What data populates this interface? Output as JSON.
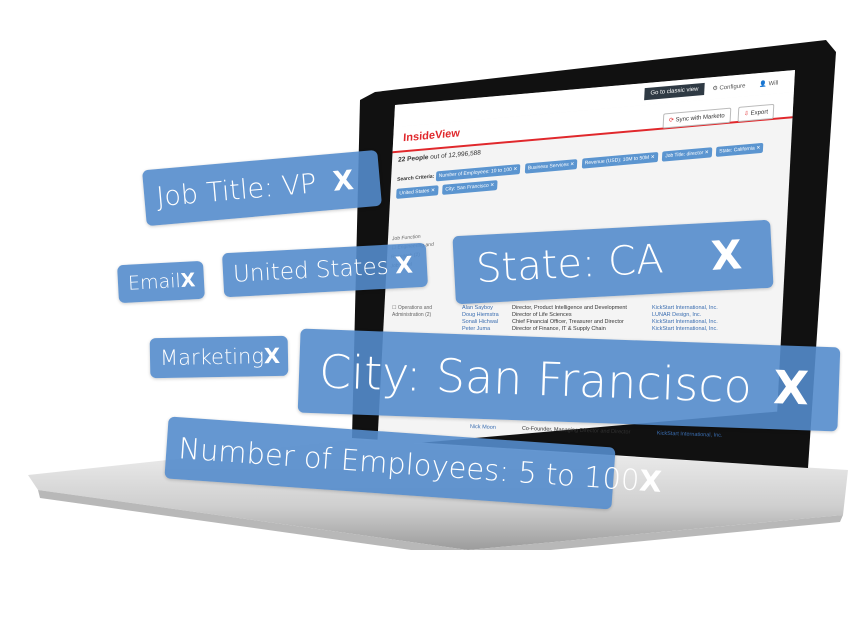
{
  "app": {
    "brand": "InsideView",
    "classic_view_button": "Go to classic view",
    "configure": "Configure",
    "user": "Will",
    "sync_button": "Sync with Marketo",
    "export_button": "Export",
    "result_count_bold": "22 People",
    "result_count_rest": "out of 12,996,588",
    "search_criteria_label": "Search Criteria:",
    "criteria": [
      "Number of Employees: 10 to 100",
      "Business Services",
      "Revenue (USD): 10M to 50M",
      "Job Title: director",
      "State: California",
      "United States",
      "City: San Francisco"
    ],
    "sidebar": {
      "job_function_label": "Job Function",
      "items": [
        "Engineering and Research (2)",
        "Operations and Administration (2)"
      ],
      "job_level_label": "Job Level"
    },
    "rows": [
      {
        "name": "Alan Sayboy",
        "title": "Director, Product Intelligence and Development",
        "company": "KickStart International, Inc."
      },
      {
        "name": "Doug Hiemstra",
        "title": "Director of Life Sciences",
        "company": "LUNAR Design, Inc."
      },
      {
        "name": "Sonali Hichwal",
        "title": "Chief Financial Officer, Treasurer and Director",
        "company": "KickStart International, Inc."
      },
      {
        "name": "Peter Juma",
        "title": "Director of Finance, IT & Supply Chain",
        "company": "KickStart International, Inc."
      },
      {
        "name": "Nick Moon",
        "title": "Co-Founder, Managing Director and Director",
        "company": "KickStart International, Inc."
      }
    ]
  },
  "chips": [
    {
      "label": "Job Title: VP",
      "close": "X"
    },
    {
      "label": "Email",
      "close": "X"
    },
    {
      "label": "United States",
      "close": "X"
    },
    {
      "label": "State: CA",
      "close": "X"
    },
    {
      "label": "Marketing",
      "close": "X"
    },
    {
      "label": "City: San Francisco",
      "close": "X"
    },
    {
      "label": "Number of Employees: 5 to 100",
      "close": "X"
    }
  ],
  "colors": {
    "chip": "#548ccc",
    "brand_red": "#e0282c",
    "bezel": "#111111"
  }
}
